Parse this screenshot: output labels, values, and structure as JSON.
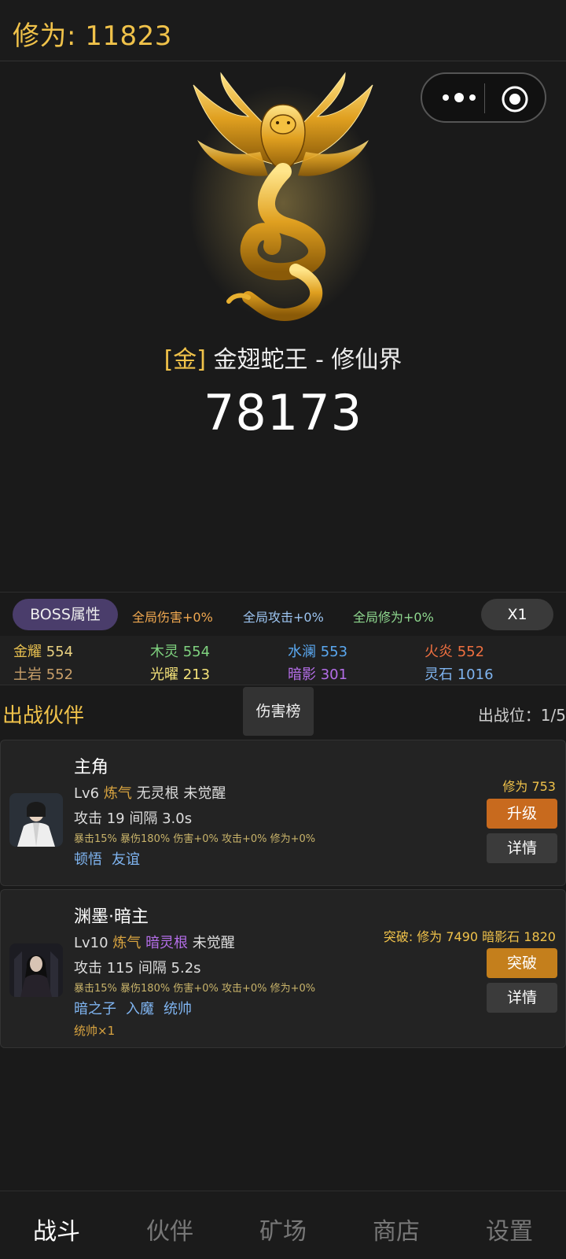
{
  "header": {
    "cultivation_label": "修为: 11823"
  },
  "boss": {
    "element_tag": "[金]",
    "name": "金翅蛇王 - 修仙界",
    "hp": "78173"
  },
  "buffs": {
    "boss_attr_label": "BOSS属性",
    "global_damage": "全局伤害+0%",
    "global_attack": "全局攻击+0%",
    "global_cultivation": "全局修为+0%",
    "speed": "X1"
  },
  "resources": [
    {
      "name": "金耀",
      "value": "554",
      "color": "#e8c050"
    },
    {
      "name": "木灵",
      "value": "554",
      "color": "#7fd27f"
    },
    {
      "name": "水澜",
      "value": "553",
      "color": "#5aa8f0"
    },
    {
      "name": "火炎",
      "value": "552",
      "color": "#f07040"
    },
    {
      "name": "土岩",
      "value": "552",
      "color": "#c9a06a"
    },
    {
      "name": "光曜",
      "value": "213",
      "color": "#f4e27a"
    },
    {
      "name": "暗影",
      "value": "301",
      "color": "#b46ee8"
    },
    {
      "name": "灵石",
      "value": "1016",
      "color": "#7fb4f0"
    }
  ],
  "partners_section": {
    "title": "出战伙伴",
    "damage_rank": "伤害榜",
    "slots": "出战位：1/5"
  },
  "partners": [
    {
      "name": "主角",
      "level": "Lv6",
      "realm": "炼气",
      "root": "无灵根",
      "awaken": "未觉醒",
      "attack": "攻击 19",
      "interval": "间隔 3.0s",
      "stats": "暴击15% 暴伤180% 伤害+0% 攻击+0% 修为+0%",
      "tags": [
        "顿悟",
        "友谊"
      ],
      "cost": "修为 753",
      "primary_action": "升级",
      "secondary_action": "详情"
    },
    {
      "name": "渊墨·暗主",
      "level": "Lv10",
      "realm": "炼气",
      "root": "暗灵根",
      "awaken": "未觉醒",
      "attack": "攻击 115",
      "interval": "间隔 5.2s",
      "stats": "暴击15% 暴伤180% 伤害+0% 攻击+0% 修为+0%",
      "tags": [
        "暗之子",
        "入魔",
        "统帅"
      ],
      "extra": "统帅×1",
      "cost": "突破: 修为 7490  暗影石 1820",
      "primary_action": "突破",
      "secondary_action": "详情"
    }
  ],
  "tabs": [
    {
      "label": "战斗",
      "active": true
    },
    {
      "label": "伙伴",
      "active": false
    },
    {
      "label": "矿场",
      "active": false
    },
    {
      "label": "商店",
      "active": false
    },
    {
      "label": "设置",
      "active": false
    }
  ]
}
